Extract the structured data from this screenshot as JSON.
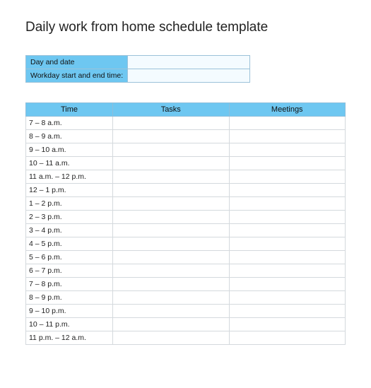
{
  "title": "Daily work from home schedule template",
  "meta": {
    "rows": [
      {
        "label": "Day and date",
        "value": ""
      },
      {
        "label": "Workday start and end time:",
        "value": ""
      }
    ]
  },
  "schedule": {
    "headers": {
      "time": "Time",
      "tasks": "Tasks",
      "meetings": "Meetings"
    },
    "rows": [
      {
        "time": "7 – 8 a.m.",
        "tasks": "",
        "meetings": ""
      },
      {
        "time": "8 – 9 a.m.",
        "tasks": "",
        "meetings": ""
      },
      {
        "time": "9 – 10 a.m.",
        "tasks": "",
        "meetings": ""
      },
      {
        "time": "10 – 11 a.m.",
        "tasks": "",
        "meetings": ""
      },
      {
        "time": "11 a.m. – 12 p.m.",
        "tasks": "",
        "meetings": ""
      },
      {
        "time": "12 – 1 p.m.",
        "tasks": "",
        "meetings": ""
      },
      {
        "time": "1 – 2 p.m.",
        "tasks": "",
        "meetings": ""
      },
      {
        "time": "2 – 3 p.m.",
        "tasks": "",
        "meetings": ""
      },
      {
        "time": "3 – 4 p.m.",
        "tasks": "",
        "meetings": ""
      },
      {
        "time": "4 – 5 p.m.",
        "tasks": "",
        "meetings": ""
      },
      {
        "time": "5 – 6 p.m.",
        "tasks": "",
        "meetings": ""
      },
      {
        "time": "6 – 7 p.m.",
        "tasks": "",
        "meetings": ""
      },
      {
        "time": "7 – 8 p.m.",
        "tasks": "",
        "meetings": ""
      },
      {
        "time": "8 – 9 p.m.",
        "tasks": "",
        "meetings": ""
      },
      {
        "time": "9 – 10 p.m.",
        "tasks": "",
        "meetings": ""
      },
      {
        "time": "10 – 11 p.m.",
        "tasks": "",
        "meetings": ""
      },
      {
        "time": "11 p.m. – 12 a.m.",
        "tasks": "",
        "meetings": ""
      }
    ]
  }
}
